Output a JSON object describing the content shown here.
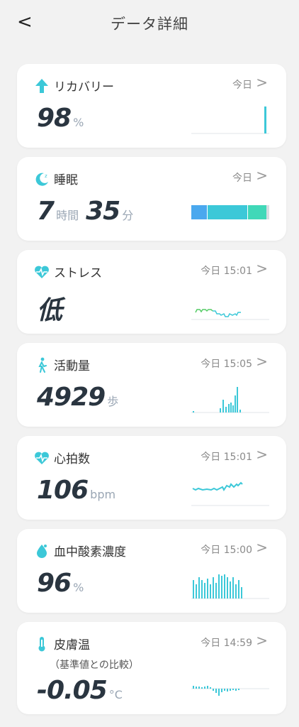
{
  "header": {
    "back": "<",
    "title": "データ詳細"
  },
  "colors": {
    "accent": "#3cc8d8",
    "green": "#55cc66",
    "blue": "#4aa8ee",
    "teal": "#40d8b8"
  },
  "cards": [
    {
      "icon": "arrow-up-icon",
      "name": "リカバリー",
      "when": "今日",
      "value": "98",
      "unit": "%"
    },
    {
      "icon": "moon-icon",
      "name": "睡眠",
      "when": "今日",
      "value_h": "7",
      "unit_h": "時間",
      "value_m": "35",
      "unit_m": "分"
    },
    {
      "icon": "heart-pulse-icon",
      "name": "ストレス",
      "when": "今日 15:01",
      "value": "低"
    },
    {
      "icon": "walking-person-icon",
      "name": "活動量",
      "when": "今日 15:05",
      "value": "4929",
      "unit": "歩"
    },
    {
      "icon": "heart-rate-icon",
      "name": "心拍数",
      "when": "今日 15:01",
      "value": "106",
      "unit": "bpm"
    },
    {
      "icon": "drop-icon",
      "name": "血中酸素濃度",
      "when": "今日 15:00",
      "value": "96",
      "unit": "%"
    },
    {
      "icon": "thermometer-icon",
      "name": "皮膚温",
      "when": "今日 14:59",
      "sub": "（基準値との比較）",
      "value": "-0.05",
      "unit": "°C"
    }
  ],
  "chevron": ">"
}
